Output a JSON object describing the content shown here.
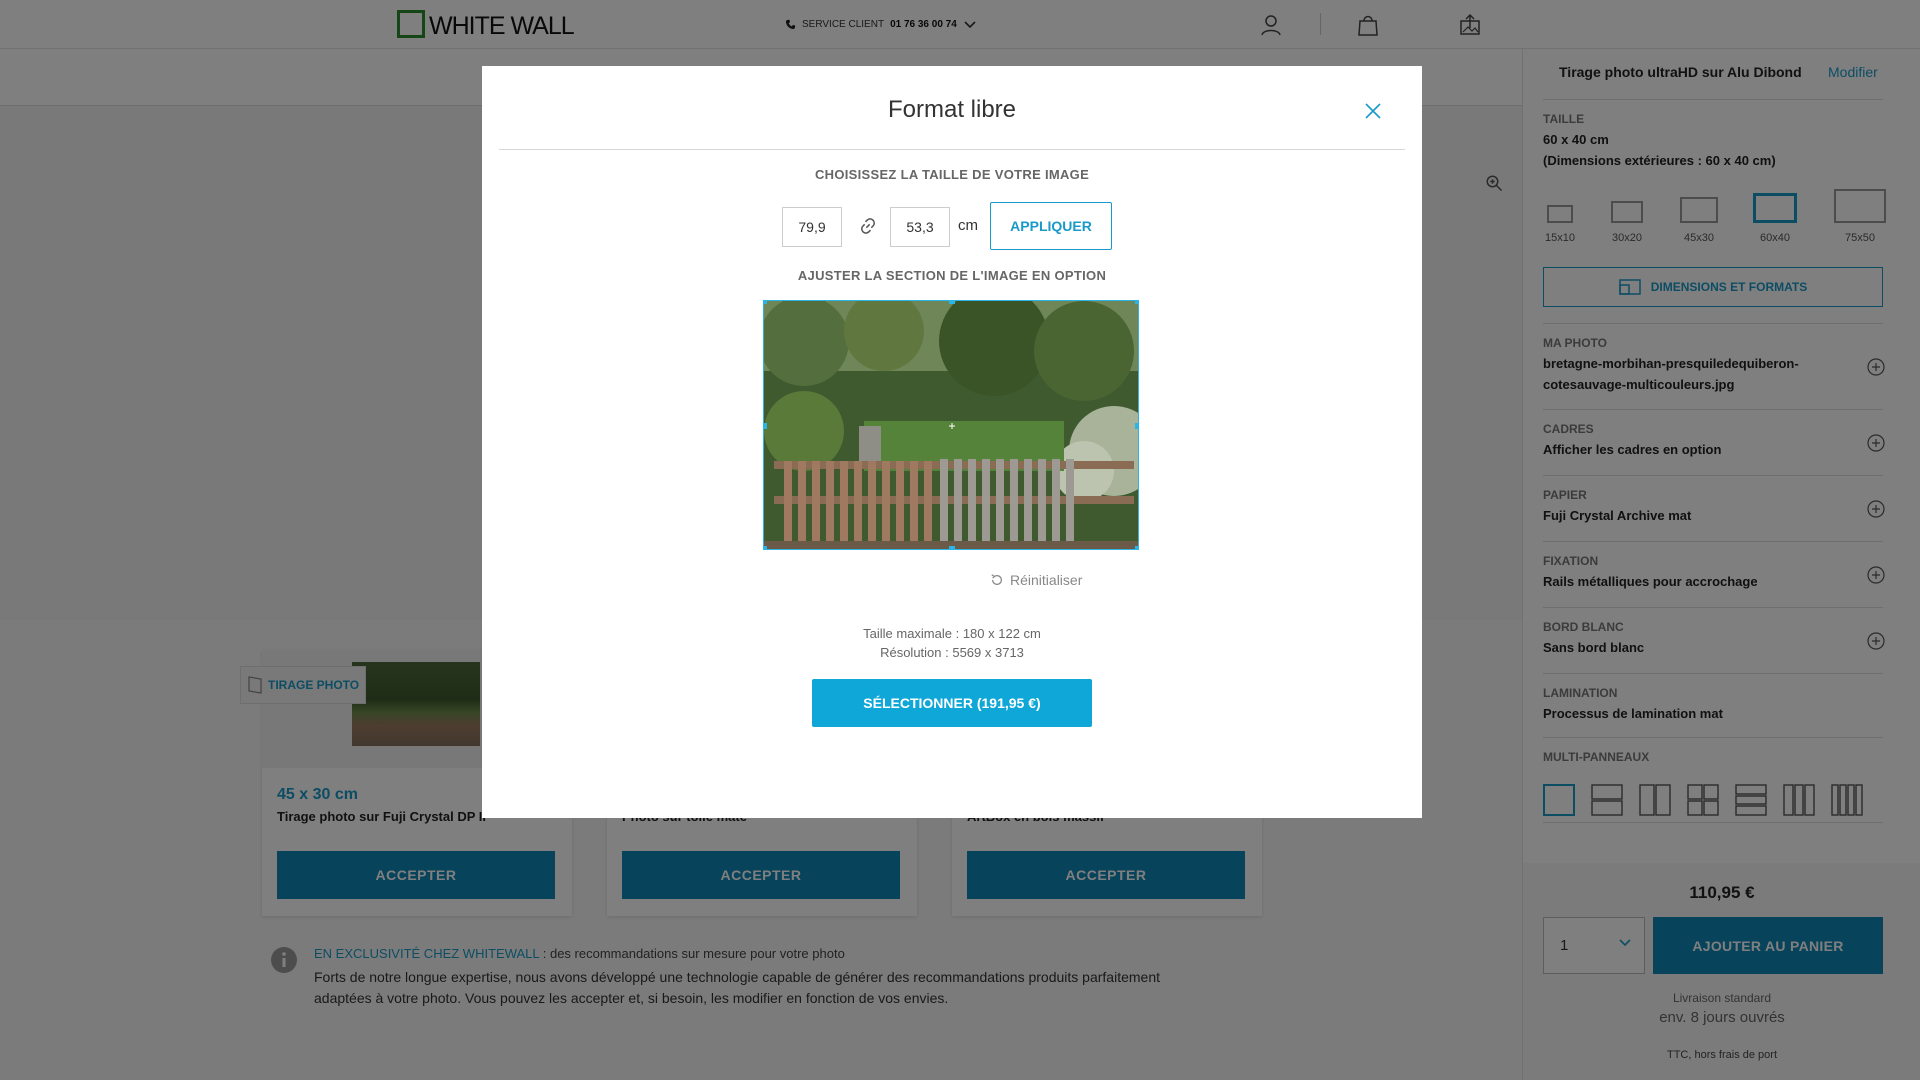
{
  "header": {
    "logo_text": "WHITE WALL",
    "service_label": "SERVICE CLIENT",
    "service_phone": "01 76 36 00 74"
  },
  "recommendations": {
    "cards": [
      {
        "badge": "TIRAGE PHOTO",
        "size": "45 x 30 cm",
        "desc": "Tirage photo sur Fuji Crystal DP II",
        "accept": "ACCEPTER"
      },
      {
        "badge": "",
        "size": "",
        "desc": "Photo sur toile mate",
        "accept": "ACCEPTER"
      },
      {
        "badge": "",
        "size": "",
        "desc": "ArtBox en bois massif",
        "accept": "ACCEPTER"
      }
    ],
    "exclu_highlight": "EN EXCLUSIVITÉ CHEZ WHITEWALL",
    "exclu_rest": " : des recommandations sur mesure pour votre photo",
    "exclu_para": "Forts de notre longue expertise, nous avons développé une technologie capable de générer des recommandations produits parfaitement adaptées à votre photo. Vous pouvez les accepter et, si besoin, les modifier en fonction de vos envies."
  },
  "panel": {
    "product_title": "Tirage photo ultraHD sur Alu Dibond",
    "modify": "Modifier",
    "taille_label": "TAILLE",
    "taille_value": "60 x 40 cm",
    "taille_ext": "(Dimensions extérieures : 60 x 40 cm)",
    "sizes": [
      "15x10",
      "30x20",
      "45x30",
      "60x40",
      "75x50"
    ],
    "dim_button": "DIMENSIONS ET FORMATS",
    "sections": [
      {
        "label": "MA PHOTO",
        "value": "bretagne-morbihan-presquiledequiberon-cotesauvage-multicouleurs.jpg",
        "expandable": true
      },
      {
        "label": "CADRES",
        "value": "Afficher les cadres en option",
        "expandable": true
      },
      {
        "label": "PAPIER",
        "value": "Fuji Crystal Archive mat",
        "expandable": true
      },
      {
        "label": "FIXATION",
        "value": "Rails métalliques pour accrochage",
        "expandable": true
      },
      {
        "label": "BORD BLANC",
        "value": "Sans bord blanc",
        "expandable": true
      },
      {
        "label": "LAMINATION",
        "value": "Processus de lamination mat",
        "expandable": false
      }
    ],
    "multi_label": "MULTI-PANNEAUX",
    "price": "110,95 €",
    "quantity": "1",
    "add_to_cart": "AJOUTER AU PANIER",
    "delivery_label": "Livraison standard",
    "delivery_time": "env. 8 jours ouvrés",
    "tax_note": "TTC, hors frais de port"
  },
  "modal": {
    "title": "Format libre",
    "choose_title": "CHOISISSEZ LA TAILLE DE VOTRE IMAGE",
    "width_value": "79,9",
    "height_value": "53,3",
    "unit": "cm",
    "apply": "APPLIQUER",
    "adjust_title": "AJUSTER LA SECTION DE L'IMAGE EN OPTION",
    "reset": "Réinitialiser",
    "max_size": "Taille maximale : 180 x 122 cm",
    "resolution": "Résolution : 5569 x 3713",
    "select_button": "SÉLECTIONNER (191,95 €)"
  },
  "colors": {
    "accent": "#1a9ac9",
    "button": "#0e87b7",
    "modal_button": "#0ea7d8",
    "logo_green": "#2d8a2d"
  }
}
